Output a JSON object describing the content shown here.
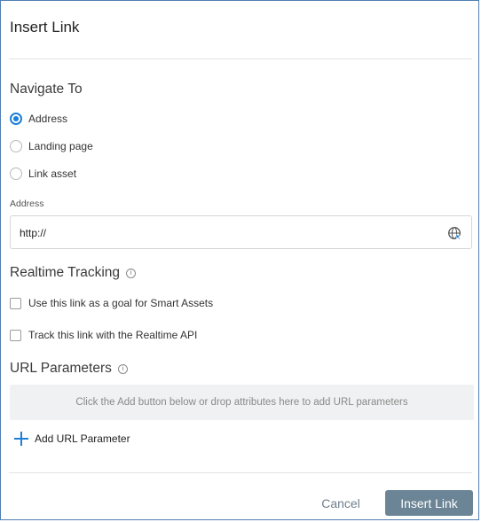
{
  "dialog": {
    "title": "Insert Link"
  },
  "navigate": {
    "title": "Navigate To",
    "options": [
      {
        "label": "Address",
        "checked": true
      },
      {
        "label": "Landing page",
        "checked": false
      },
      {
        "label": "Link asset",
        "checked": false
      }
    ]
  },
  "address": {
    "label": "Address",
    "value": "http://"
  },
  "tracking": {
    "title": "Realtime Tracking",
    "options": [
      {
        "label": "Use this link as a goal for Smart Assets",
        "checked": false
      },
      {
        "label": "Track this link with the Realtime API",
        "checked": false
      }
    ]
  },
  "url_params": {
    "title": "URL Parameters",
    "drop_hint": "Click the Add button below or drop attributes here to add URL parameters",
    "add_label": "Add URL Parameter"
  },
  "footer": {
    "cancel_label": "Cancel",
    "insert_label": "Insert Link"
  },
  "colors": {
    "accent": "#1e7fd6",
    "primary_button": "#6c8596",
    "dialog_border": "#4f7fb3"
  },
  "icons": {
    "info": "info-icon",
    "globe": "globe-icon",
    "plus": "plus-icon"
  }
}
